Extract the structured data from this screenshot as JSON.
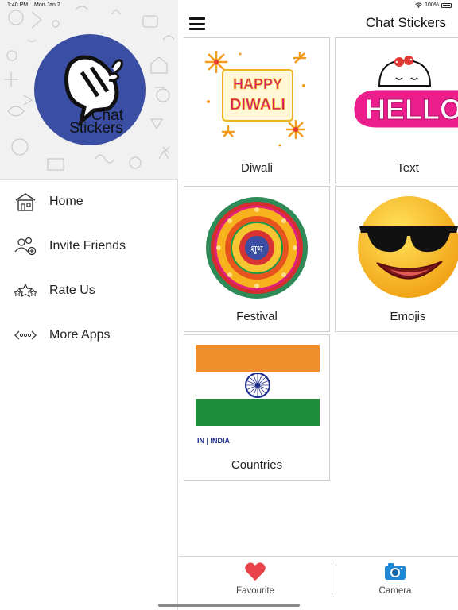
{
  "status": {
    "time": "1:40 PM",
    "date": "Mon Jan 2",
    "battery": "100%"
  },
  "sidebar": {
    "logo_line1": "Chat",
    "logo_line2": "Stickers",
    "items": [
      {
        "label": "Home",
        "icon": "home-icon"
      },
      {
        "label": "Invite Friends",
        "icon": "invite-friends-icon"
      },
      {
        "label": "Rate Us",
        "icon": "rate-stars-icon"
      },
      {
        "label": "More Apps",
        "icon": "more-apps-icon"
      }
    ]
  },
  "header": {
    "title": "Chat Stickers"
  },
  "categories": [
    {
      "label": "Diwali",
      "art_text1": "HAPPY",
      "art_text2": "DIWALI"
    },
    {
      "label": "Text",
      "art_text": "HELLO"
    },
    {
      "label": "Festival",
      "art_text": "शुभ"
    },
    {
      "label": "Emojis"
    },
    {
      "label": "Countries",
      "art_caption": "IN | INDIA"
    }
  ],
  "tabs": {
    "favourite_label": "Favourite",
    "camera_label": "Camera"
  },
  "colors": {
    "logo_circle": "#3a4ea3",
    "heart": "#e8424b",
    "camera": "#1e88d6",
    "flag_saffron": "#f08d2c",
    "flag_green": "#1f8c3b",
    "flag_chakra": "#1b2a8a"
  }
}
